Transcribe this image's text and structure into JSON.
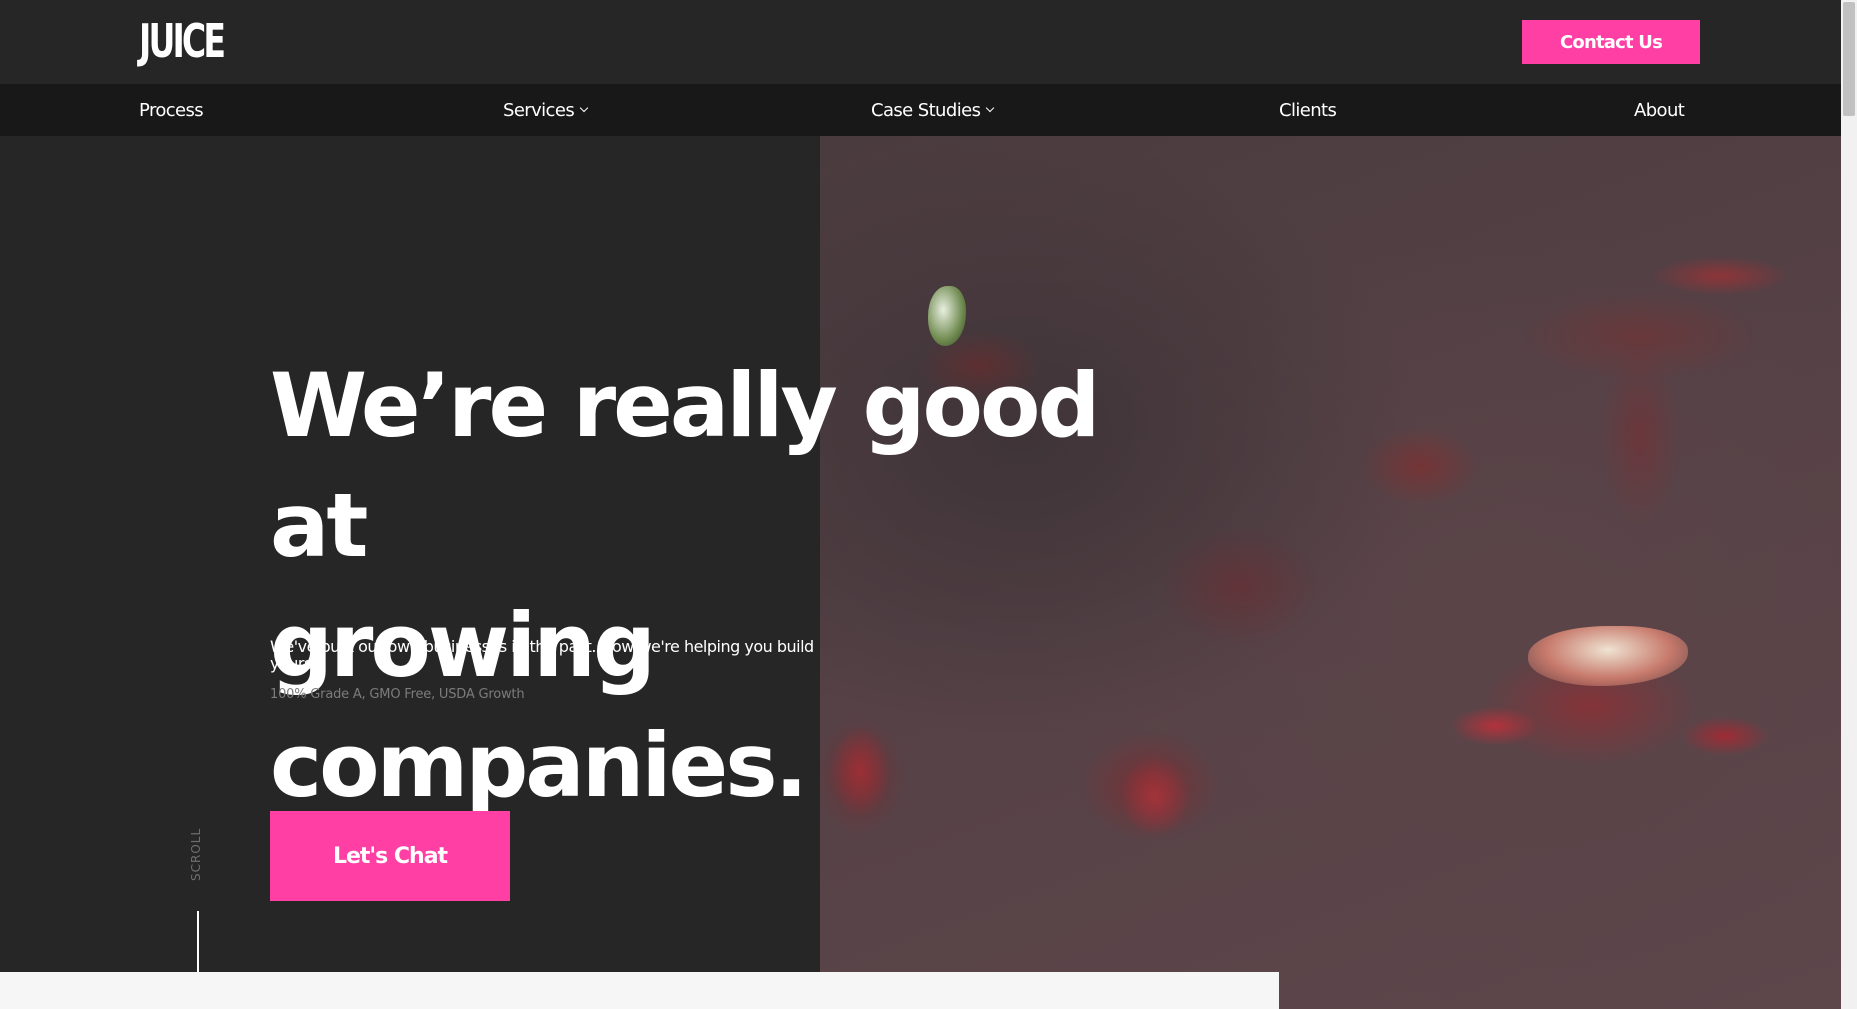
{
  "header": {
    "logo": "JUICE",
    "contact_label": "Contact Us"
  },
  "nav": {
    "items": [
      {
        "label": "Process",
        "has_dropdown": false
      },
      {
        "label": "Services",
        "has_dropdown": true
      },
      {
        "label": "Case Studies",
        "has_dropdown": true
      },
      {
        "label": "Clients",
        "has_dropdown": false
      },
      {
        "label": "About",
        "has_dropdown": false
      }
    ]
  },
  "hero": {
    "headline_line1": "We’re really good at",
    "headline_line2": "growing companies.",
    "subtext": "We've built our own businesses in the past. Now we're helping you build yours.",
    "finetext": "100% Grade A, GMO Free, USDA Growth",
    "cta_label": "Let's Chat",
    "scroll_label": "SCROLL"
  },
  "colors": {
    "accent": "#ff3fa4",
    "background": "#262626",
    "nav_background": "#181818"
  },
  "icons": {
    "dropdown": "chevron-down-icon"
  }
}
